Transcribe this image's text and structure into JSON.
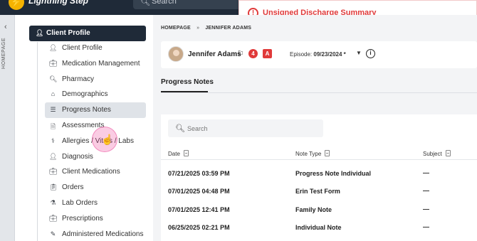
{
  "app": {
    "name": "Lightning Step"
  },
  "top_search": {
    "placeholder": "Search"
  },
  "alert": {
    "text": "Unsigned Discharge Summary"
  },
  "rail": {
    "label": "HOMEPAGE"
  },
  "sidebar": {
    "header": "Client Profile",
    "items": [
      {
        "label": "Client Profile",
        "icon": "person-icon"
      },
      {
        "label": "Medication Management",
        "icon": "briefcase-icon"
      },
      {
        "label": "Pharmacy",
        "icon": "search-icon"
      },
      {
        "label": "Demographics",
        "icon": "home-icon"
      },
      {
        "label": "Progress Notes",
        "icon": "list-icon",
        "active": true
      },
      {
        "label": "Assessments",
        "icon": "document-icon"
      },
      {
        "label": "Allergies / Vitals / Labs",
        "icon": "stethoscope-icon"
      },
      {
        "label": "Diagnosis",
        "icon": "person-icon"
      },
      {
        "label": "Client Medications",
        "icon": "briefcase-icon"
      },
      {
        "label": "Orders",
        "icon": "clipboard-icon"
      },
      {
        "label": "Lab Orders",
        "icon": "flask-icon"
      },
      {
        "label": "Prescriptions",
        "icon": "briefcase-icon"
      },
      {
        "label": "Administered Medications",
        "icon": "syringe-icon"
      }
    ]
  },
  "breadcrumb": {
    "home": "HOMEPAGE",
    "separator": "»",
    "current": "JENNIFER ADAMS"
  },
  "client": {
    "name": "Jennifer Adams",
    "alert_count": "4",
    "badge_letter": "A",
    "episode_label": "Episode:",
    "episode_value": "09/23/2024 *"
  },
  "tabs": {
    "active": "Progress Notes"
  },
  "notes": {
    "search_placeholder": "Search",
    "columns": [
      "Date",
      "Note Type",
      "Subject"
    ],
    "rows": [
      {
        "date": "07/21/2025 03:59 PM",
        "type": "Progress Note Individual",
        "subject": "—"
      },
      {
        "date": "07/01/2025 04:48 PM",
        "type": "Erin Test Form",
        "subject": "—"
      },
      {
        "date": "07/01/2025 12:41 PM",
        "type": "Family Note",
        "subject": "—"
      },
      {
        "date": "06/25/2025 02:21 PM",
        "type": "Individual Note",
        "subject": "—"
      }
    ]
  },
  "colors": {
    "dark_navy": "#1f2a38",
    "alert_red": "#e03a3a",
    "active_item_bg": "#dfe3e8",
    "cursor_highlight": "#ec4899"
  }
}
